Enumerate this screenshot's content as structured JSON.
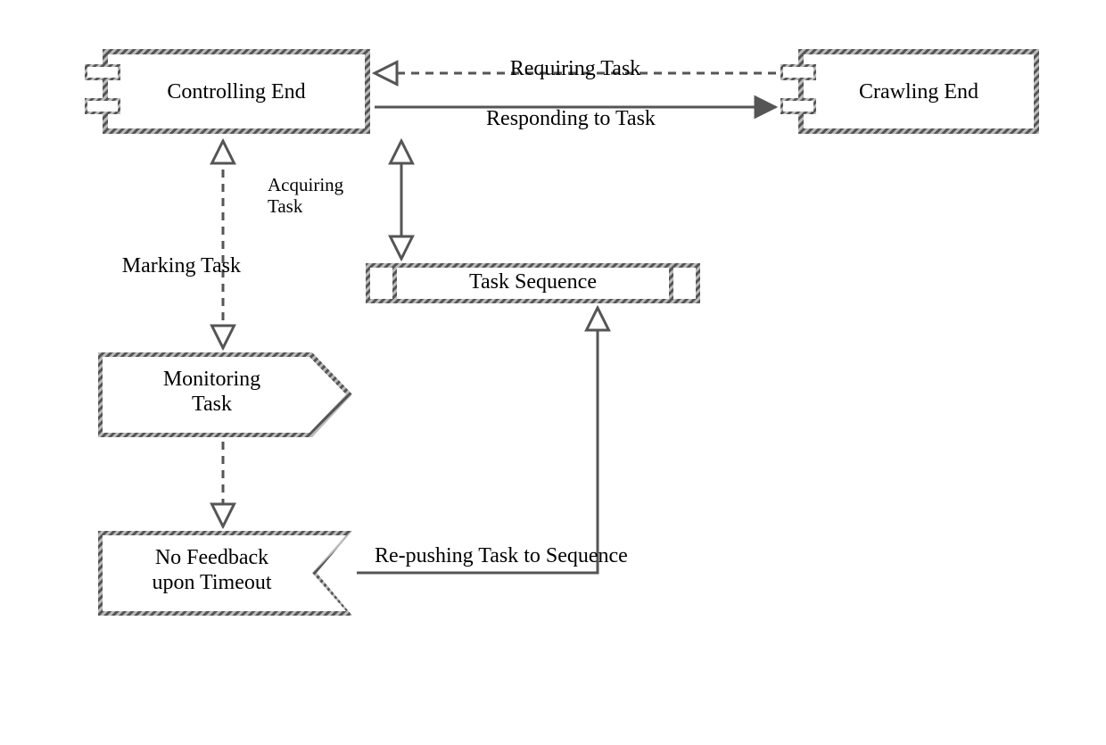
{
  "nodes": {
    "controlling": {
      "label": "Controlling End"
    },
    "crawling": {
      "label": "Crawling End"
    },
    "task_sequence": {
      "label": "Task Sequence"
    },
    "monitoring": {
      "label": "Monitoring\nTask"
    },
    "no_feedback": {
      "label": "No Feedback\nupon Timeout"
    }
  },
  "edges": {
    "requiring": {
      "label": "Requiring Task"
    },
    "responding": {
      "label": "Responding to Task"
    },
    "acquiring": {
      "label": "Acquiring\nTask"
    },
    "marking": {
      "label": "Marking Task"
    },
    "repush": {
      "label": "Re-pushing Task to Sequence"
    }
  },
  "style": {
    "stroke": "#555555",
    "hatch_a": "#555555",
    "hatch_b": "#bbbbbb"
  }
}
